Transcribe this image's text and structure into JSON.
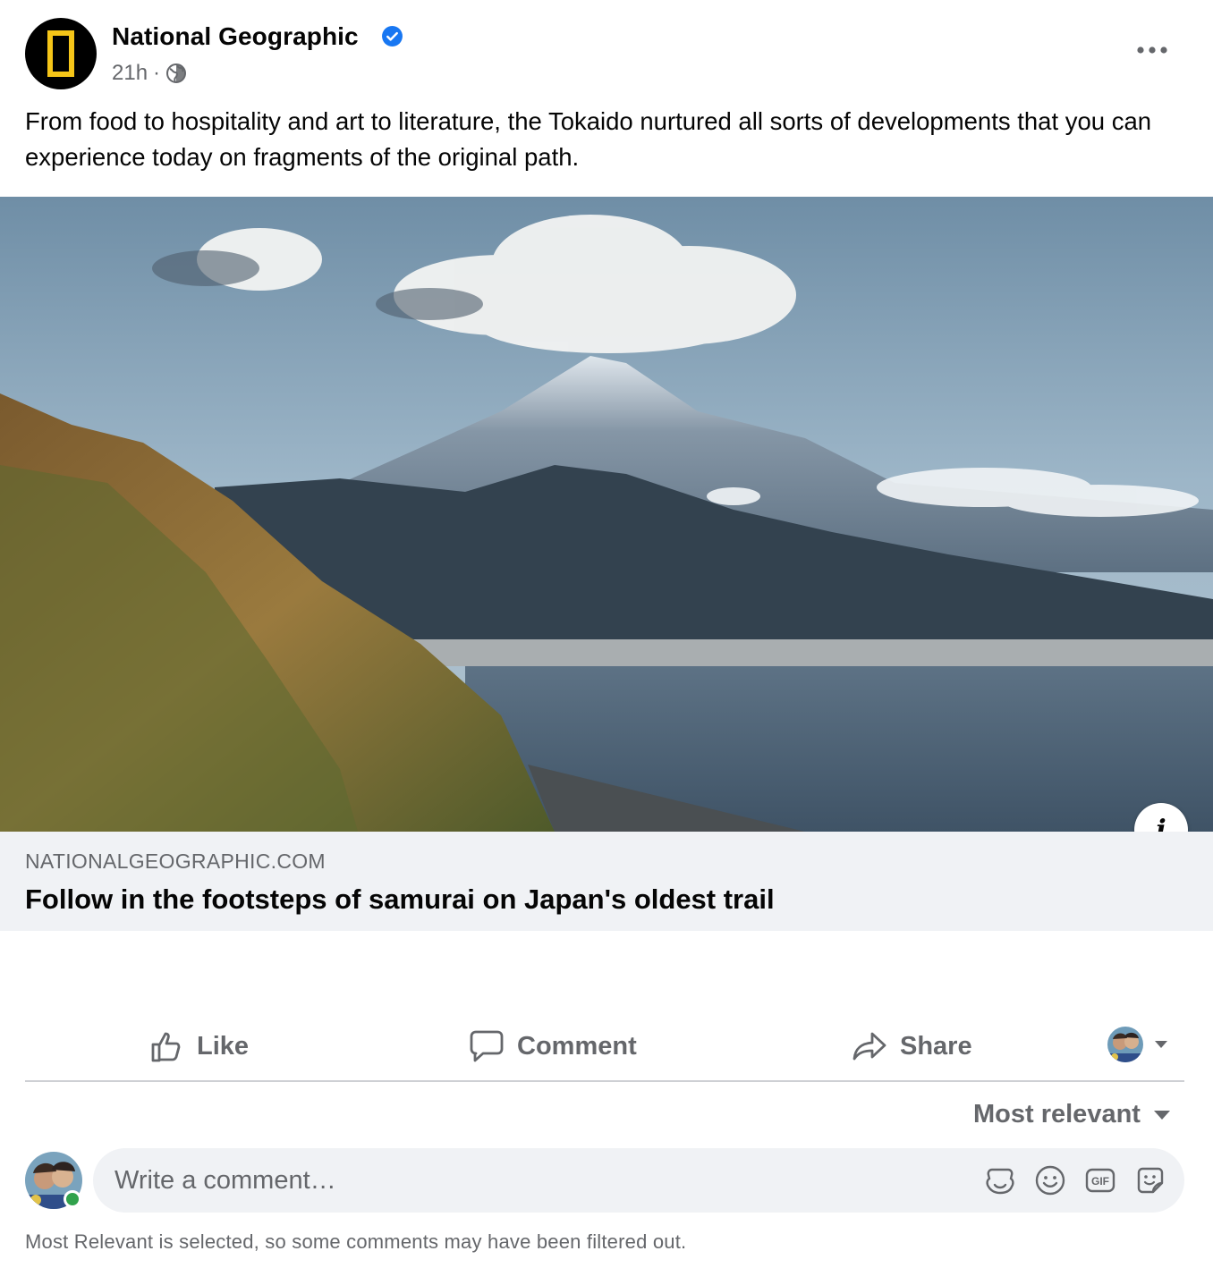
{
  "post": {
    "page_name": "National Geographic",
    "timestamp": "21h",
    "separator": "·",
    "audience_icon": "globe-icon",
    "verified_icon": "verified-badge-icon",
    "more_icon": "more-options-icon",
    "text": "From food to hospitality and art to literature, the Tokaido nurtured all sorts of developments that you can experience today on fragments of the original path."
  },
  "link": {
    "image_alt": "Mount Fuji rising above clouds over a bay with green hills",
    "info_label": "i",
    "domain": "NATIONALGEOGRAPHIC.COM",
    "title": "Follow in the footsteps of samurai on Japan's oldest trail"
  },
  "actions": {
    "like": "Like",
    "comment": "Comment",
    "share": "Share"
  },
  "comments": {
    "sort_label": "Most relevant",
    "placeholder": "Write a comment…",
    "composer_icons": [
      "avatar-sticker-icon",
      "emoji-icon",
      "gif-icon",
      "sticker-icon"
    ],
    "filter_notice": "Most Relevant is selected, so some comments may have been filtered out."
  },
  "colors": {
    "verified": "#1877f2",
    "secondary_text": "#65676b",
    "footer_bg": "#f0f2f5",
    "logo_yellow": "#f5c518",
    "online": "#31a24c"
  }
}
